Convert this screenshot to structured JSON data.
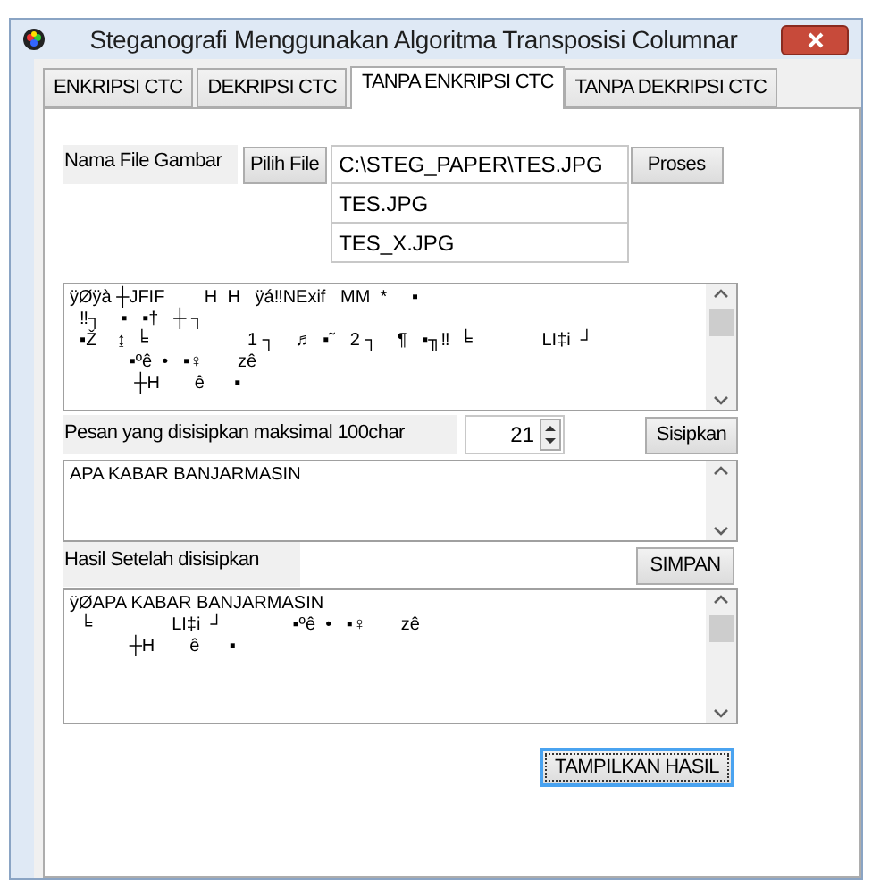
{
  "window": {
    "title": "Steganografi Menggunakan Algoritma Transposisi Columnar"
  },
  "tabs": [
    {
      "label": "ENKRIPSI CTC",
      "selected": false
    },
    {
      "label": "DEKRIPSI CTC",
      "selected": false
    },
    {
      "label": "TANPA ENKRIPSI CTC",
      "selected": true
    },
    {
      "label": "TANPA DEKRIPSI CTC",
      "selected": false
    }
  ],
  "file_row": {
    "label": "Nama File Gambar",
    "button": "Pilih File",
    "path": "C:\\STEG_PAPER\\TES.JPG",
    "action": "Proses",
    "files": [
      "TES.JPG",
      "TES_X.JPG"
    ]
  },
  "image_text": [
    "ÿØÿà ┼JFIF        H  H   ÿá‼NExif   MM  *     ▪",
    "  ‼┐    ▪   ▪†   ┼ ┐",
    "  ▪Ž    ↨  ╘                    1 ┐    ♬  ▪˜   2 ┐    ¶   ▪╖‼  ╘              LI‡i  ┘",
    "            ▪ºê  •   ▪♀       zê",
    "             ┼H       ê      ▪"
  ],
  "message_row": {
    "label": "Pesan yang disisipkan maksimal  100char",
    "count": "21",
    "button": "Sisipkan"
  },
  "message_text": "APA KABAR BANJARMASIN",
  "result_row": {
    "label": "Hasil Setelah disisipkan",
    "button": "SIMPAN"
  },
  "result_text": [
    "ÿØAPA KABAR BANJARMASIN",
    "  ╘                LI‡i  ┘              ▪ºê  •   ▪♀       zê",
    "            ┼H       ê      ▪"
  ],
  "show_button": {
    "label": "TAMPILKAN HASIL",
    "focused": true
  }
}
